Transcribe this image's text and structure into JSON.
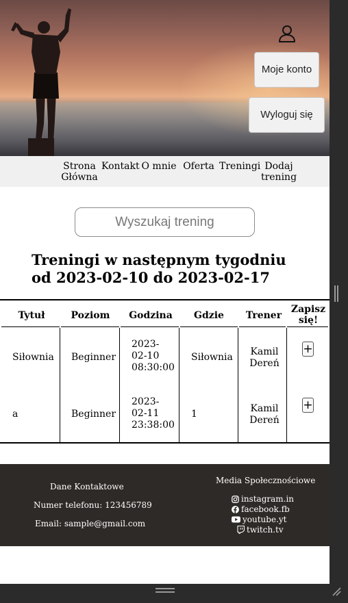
{
  "header": {
    "account_button": "Moje konto",
    "logout_button": "Wyloguj się"
  },
  "nav": {
    "items": [
      "Strona Główna",
      "Kontakt",
      "O mnie",
      "Oferta",
      "Treningi",
      "Dodaj trening"
    ]
  },
  "search": {
    "placeholder": "Wyszukaj trening"
  },
  "main": {
    "heading": "Treningi w następnym tygodniu od 2023-02-10 do 2023-02-17"
  },
  "table": {
    "headers": [
      "Tytuł",
      "Poziom",
      "Godzina",
      "Gdzie",
      "Trener",
      "Zapisz się!"
    ],
    "rows": [
      {
        "title": "Siłownia",
        "level": "Beginner",
        "time": "2023-02-10 08:30:00",
        "where": "Siłownia",
        "trainer": "Kamil Dereń",
        "signup": "+"
      },
      {
        "title": "a",
        "level": "Beginner",
        "time": "2023-02-11 23:38:00",
        "where": "1",
        "trainer": "Kamil Dereń",
        "signup": "+"
      }
    ]
  },
  "footer": {
    "contact_title": "Dane Kontaktowe",
    "phone": "Numer telefonu: 123456789",
    "email": "Email: sample@gmail.com",
    "social_title": "Media Społecznościowe",
    "social": [
      {
        "icon": "instagram-icon",
        "label": "instagram.in"
      },
      {
        "icon": "facebook-icon",
        "label": "facebook.fb"
      },
      {
        "icon": "youtube-icon",
        "label": "youtube.yt"
      },
      {
        "icon": "twitch-icon",
        "label": "twitch.tv"
      }
    ]
  },
  "colors": {
    "footer_bg": "#2e2a27",
    "nav_bg": "#f0f0f0",
    "button_bg": "#f1f1f1"
  }
}
